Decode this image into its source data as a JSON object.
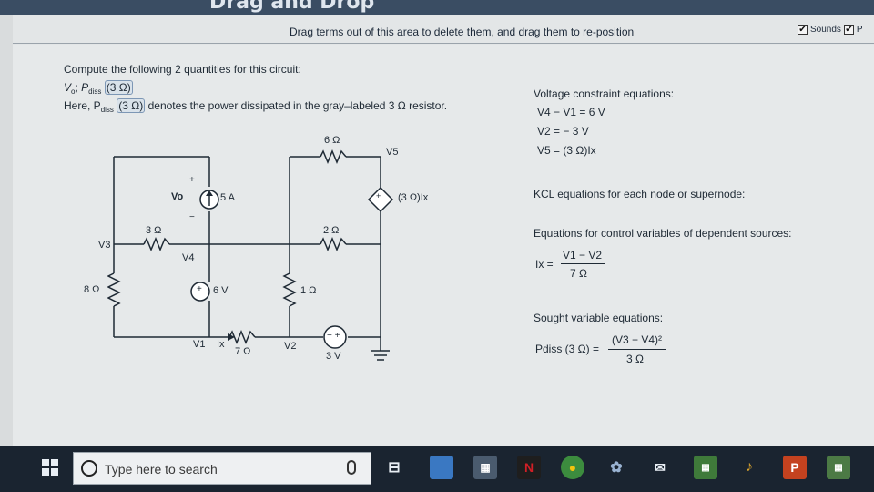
{
  "toolbar": {
    "drag_hint": "Drag terms out of this area to delete them, and drag them to re-position",
    "sounds_label": "Sounds",
    "sounds_checked": true,
    "p_checked": true,
    "p_label": "P"
  },
  "problem": {
    "intro": "Compute the following 2 quantities for this circuit:",
    "q1": "V",
    "q1_sub": "o",
    "q_sep": ";",
    "q2": "P",
    "q2_sub": "diss",
    "q2_arg": "(3 Ω)",
    "note_pre": "Here, P",
    "note_sub": "diss",
    "note_arg": "(3 Ω)",
    "note_post": "denotes the power dissipated in the gray–labeled 3 Ω resistor."
  },
  "circuit": {
    "r6_label": "6 Ω",
    "v5_label": "V5",
    "vo_label": "Vo",
    "cs_label": "5 A",
    "dep_source_label": "(3 Ω)Ix",
    "r3_label": "3 Ω",
    "r2_label": "2 Ω",
    "v3_label": "V3",
    "v4_label": "V4",
    "r8_label": "8 Ω",
    "vs6_label": "6 V",
    "r1_label": "1 Ω",
    "v1_label": "V1",
    "ix_label": "Ix",
    "r7_label": "7 Ω",
    "v2_label": "V2",
    "vs3_label": "3 V",
    "plus": "+",
    "minus": "−"
  },
  "equations": {
    "voltage_title": "Voltage constraint equations:",
    "vc1": "V4 − V1 = 6 V",
    "vc2": "V2 = − 3 V",
    "vc3": "V5 = (3 Ω)Ix",
    "kcl_title": "KCL equations for each node or supernode:",
    "control_title": "Equations for control variables of dependent sources:",
    "ix_lhs": "Ix =",
    "ix_num": "V1 − V2",
    "ix_den": "7 Ω",
    "sought_title": "Sought variable equations:",
    "pd_lhs": "Pdiss (3 Ω) =",
    "pd_num": "(V3 − V4)²",
    "pd_den": "3 Ω"
  },
  "taskbar": {
    "search_placeholder": "Type here to search",
    "netflix_letter": "N",
    "powerpoint_letter": "P"
  },
  "colors": {
    "taskbar": "#1a2430",
    "content_bg": "#e6e9ea",
    "accent_blue": "#7d97b5"
  }
}
